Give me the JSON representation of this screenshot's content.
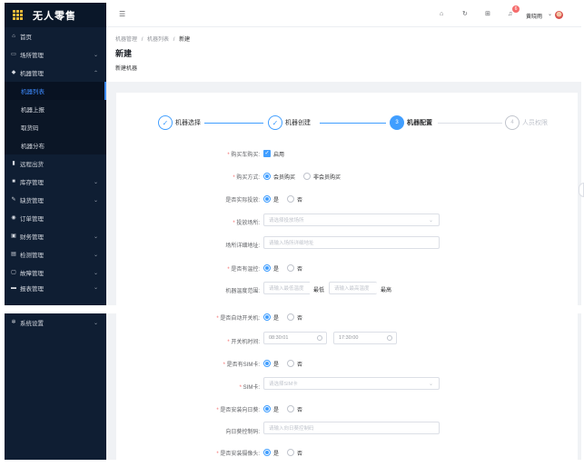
{
  "app": {
    "title": "无人零售"
  },
  "sidebar": {
    "items": [
      {
        "label": "首页",
        "icon": "home-icon",
        "arrow": ""
      },
      {
        "label": "场所管理",
        "icon": "shop-icon",
        "arrow": "⌄"
      },
      {
        "label": "机器管理",
        "icon": "android-icon",
        "arrow": "⌃"
      },
      {
        "label": "机器列表",
        "icon": "",
        "arrow": "",
        "sub": true,
        "active": true
      },
      {
        "label": "机器上报",
        "icon": "",
        "arrow": "",
        "sub": true
      },
      {
        "label": "取货码",
        "icon": "",
        "arrow": "",
        "sub": true
      },
      {
        "label": "机器分布",
        "icon": "",
        "arrow": "",
        "sub": true
      },
      {
        "label": "远程出货",
        "icon": "remote-icon",
        "arrow": ""
      },
      {
        "label": "库存管理",
        "icon": "stock-icon",
        "arrow": "⌄"
      },
      {
        "label": "缺货管理",
        "icon": "shortage-icon",
        "arrow": "⌄"
      },
      {
        "label": "订单管理",
        "icon": "order-icon",
        "arrow": ""
      },
      {
        "label": "财务管理",
        "icon": "finance-icon",
        "arrow": "⌄"
      },
      {
        "label": "检测管理",
        "icon": "detect-icon",
        "arrow": "⌄"
      },
      {
        "label": "故障管理",
        "icon": "fault-icon",
        "arrow": "⌄"
      },
      {
        "label": "报表管理",
        "icon": "report-icon",
        "arrow": "⌄"
      }
    ],
    "bottom_item": {
      "label": "系统设置",
      "arrow": "⌄"
    }
  },
  "header": {
    "notification_count": "6",
    "user_name": "黄晓雨"
  },
  "breadcrumb": {
    "items": [
      "机器管理",
      "机器列表",
      "新建"
    ],
    "sep": "/"
  },
  "page": {
    "title": "新建",
    "subtitle": "新建机器"
  },
  "steps": [
    {
      "num": "✓",
      "label": "机器选择",
      "state": "done"
    },
    {
      "num": "✓",
      "label": "机器创建",
      "state": "done"
    },
    {
      "num": "3",
      "label": "机器配置",
      "state": "current"
    },
    {
      "num": "4",
      "label": "人员权限",
      "state": "wait"
    }
  ],
  "form": {
    "cart": {
      "label": "购买车购买:",
      "option": "启用"
    },
    "buy_mode": {
      "label": "购买方式:",
      "opt1": "会员购买",
      "opt2": "非会员购买"
    },
    "deliver": {
      "label": "是否实际投放:",
      "yes": "是",
      "no": "否"
    },
    "place": {
      "label": "投放场所:",
      "placeholder": "请选择投放场所"
    },
    "place_detail": {
      "label": "场所详细地址:",
      "placeholder": "请输入场所详细地址"
    },
    "temp_ctrl": {
      "label": "是否有温控:",
      "yes": "是",
      "no": "否"
    },
    "temp_range": {
      "label": "机器温度范围:",
      "low_ph": "请输入最低温度",
      "low": "最低",
      "high_ph": "请输入最高温度",
      "high": "最高"
    },
    "auto_switch": {
      "label": "是否自动开关机:",
      "yes": "是",
      "no": "否"
    },
    "switch_time": {
      "label": "开关机时间:",
      "start": "08:30:01",
      "end": "17:30:00"
    },
    "sim": {
      "label": "是否有SIM卡:",
      "yes": "是",
      "no": "否"
    },
    "sim_card": {
      "label": "SIM卡:",
      "placeholder": "请选择SIM卡"
    },
    "sunflower": {
      "label": "是否安装向日葵:",
      "yes": "是",
      "no": "否"
    },
    "sunflower_code": {
      "label": "向日葵控制码:",
      "placeholder": "请输入向日葵控制码"
    },
    "camera": {
      "label": "是否安装摄像头:",
      "yes": "是",
      "no": "否"
    }
  }
}
